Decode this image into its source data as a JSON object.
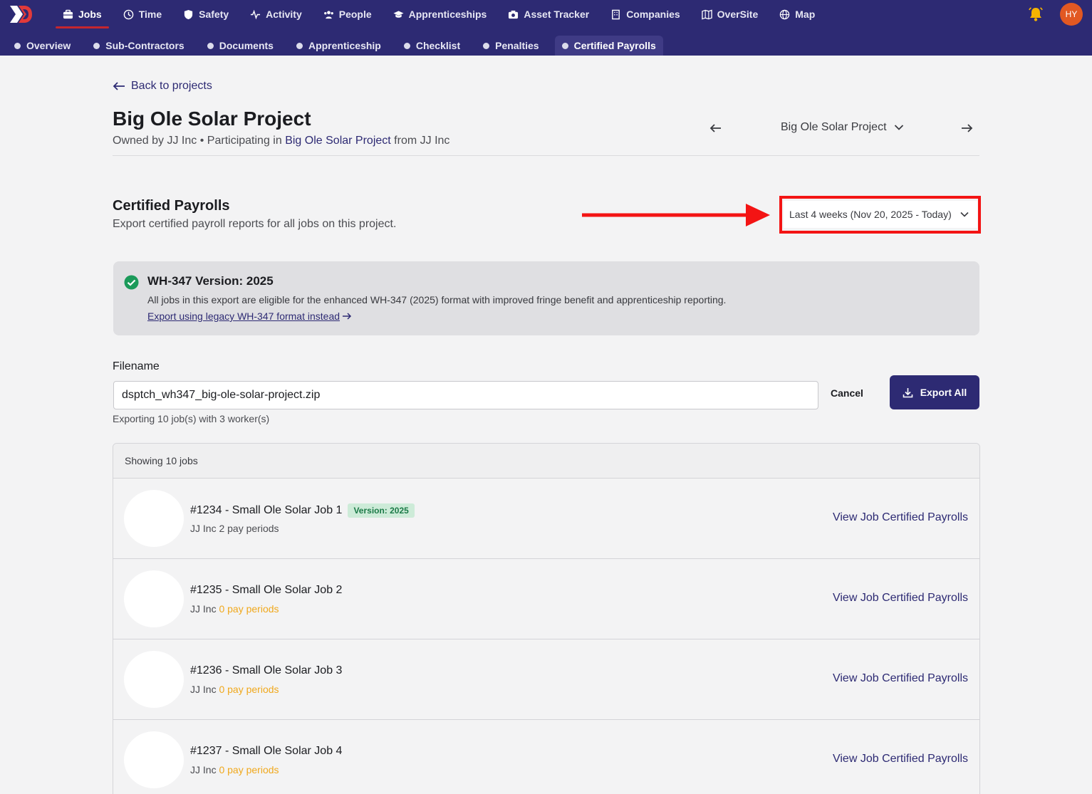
{
  "nav": {
    "primary": [
      {
        "label": "Jobs",
        "icon": "briefcase-icon",
        "active": true
      },
      {
        "label": "Time",
        "icon": "clock-icon"
      },
      {
        "label": "Safety",
        "icon": "shield-icon"
      },
      {
        "label": "Activity",
        "icon": "activity-icon"
      },
      {
        "label": "People",
        "icon": "people-icon"
      },
      {
        "label": "Apprenticeships",
        "icon": "graduation-cap-icon"
      },
      {
        "label": "Asset Tracker",
        "icon": "camera-icon"
      },
      {
        "label": "Companies",
        "icon": "building-icon"
      },
      {
        "label": "OverSite",
        "icon": "map-book-icon"
      },
      {
        "label": "Map",
        "icon": "globe-icon"
      }
    ],
    "secondary": [
      "Overview",
      "Sub-Contractors",
      "Documents",
      "Apprenticeship",
      "Checklist",
      "Penalties",
      "Certified Payrolls"
    ],
    "avatar_initials": "HY"
  },
  "header": {
    "back_label": "Back to projects",
    "title": "Big Ole Solar Project",
    "owned_by": "Owned by JJ Inc",
    "bullet": "•",
    "participating_prefix": "Participating in",
    "participating_project": "Big Ole Solar Project",
    "participating_suffix": "from JJ Inc",
    "project_select": "Big Ole Solar Project"
  },
  "section": {
    "title": "Certified Payrolls",
    "description": "Export certified payroll reports for all jobs on this project.",
    "date_range": "Last 4 weeks (Nov 20, 2025 - Today)"
  },
  "info": {
    "title": "WH-347 Version: 2025",
    "text": "All jobs in this export are eligible for the enhanced WH-347 (2025) format with improved fringe benefit and apprenticeship reporting.",
    "link": "Export using legacy WH-347 format instead"
  },
  "export": {
    "filename_label": "Filename",
    "filename": "dsptch_wh347_big-ole-solar-project.zip",
    "summary": "Exporting 10 job(s) with 3 worker(s)",
    "cancel": "Cancel",
    "export_all": "Export All"
  },
  "jobs": {
    "header": "Showing 10 jobs",
    "link_label": "View Job Certified Payrolls",
    "rows": [
      {
        "title": "#1234 - Small Ole Solar Job 1",
        "badge": "Version: 2025",
        "company": "JJ Inc",
        "pay_periods": "2 pay periods"
      },
      {
        "title": "#1235 - Small Ole Solar Job 2",
        "badge": "",
        "company": "JJ Inc",
        "pay_periods": "0 pay periods"
      },
      {
        "title": "#1236 - Small Ole Solar Job 3",
        "badge": "",
        "company": "JJ Inc",
        "pay_periods": "0 pay periods"
      },
      {
        "title": "#1237 - Small Ole Solar Job 4",
        "badge": "",
        "company": "JJ Inc",
        "pay_periods": "0 pay periods"
      }
    ]
  },
  "colors": {
    "nav_bg": "#2d2a73",
    "accent_red": "#f31414",
    "warning": "#f0a81c",
    "success": "#1b9a5a"
  }
}
